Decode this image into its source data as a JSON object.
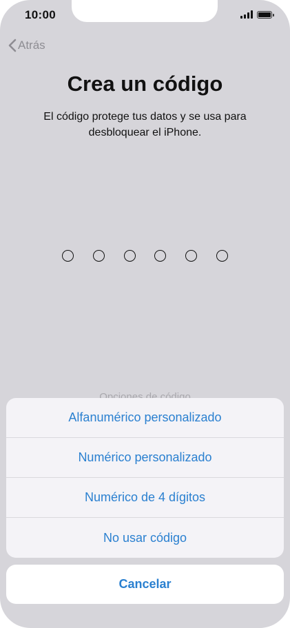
{
  "status_bar": {
    "time": "10:00",
    "signal_icon": "cellular-signal-icon",
    "battery_icon": "battery-icon"
  },
  "nav": {
    "back_label": "Atrás",
    "back_icon": "chevron-left-icon"
  },
  "header": {
    "title": "Crea un código",
    "subtitle": "El código protege tus datos y se usa para desbloquear el iPhone."
  },
  "passcode": {
    "length": 6,
    "entered": 0
  },
  "options_link": {
    "label": "Opciones de código"
  },
  "action_sheet": {
    "options": [
      {
        "label": "Alfanumérico personalizado"
      },
      {
        "label": "Numérico personalizado"
      },
      {
        "label": "Numérico de 4 dígitos"
      },
      {
        "label": "No usar código"
      }
    ],
    "cancel_label": "Cancelar"
  },
  "colors": {
    "accent": "#2a80d0",
    "dimmed_background": "#d6d5da",
    "sheet_background": "#f4f3f7"
  }
}
